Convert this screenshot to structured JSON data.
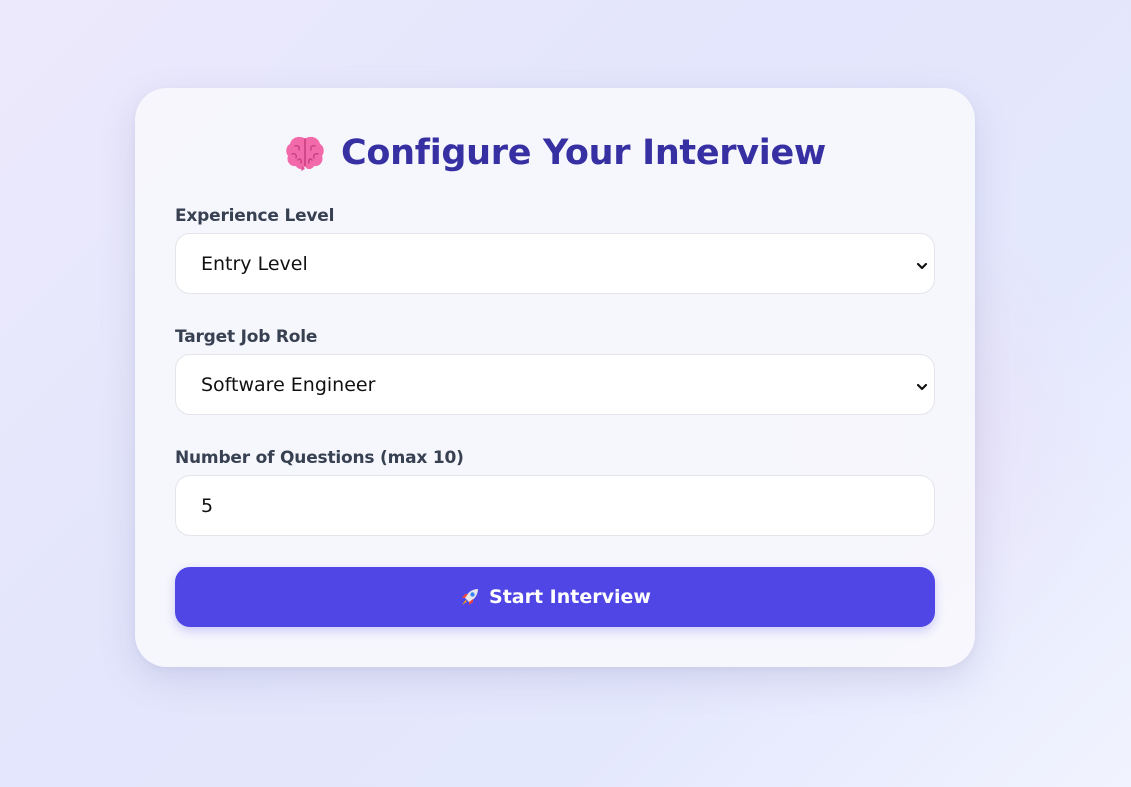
{
  "form": {
    "title": "Configure Your Interview",
    "title_icon": "brain-icon",
    "experience": {
      "label": "Experience Level",
      "selected": "Entry Level"
    },
    "role": {
      "label": "Target Job Role",
      "selected": "Software Engineer"
    },
    "questions": {
      "label": "Number of Questions (max 10)",
      "value": "5"
    },
    "submit": {
      "label": "Start Interview",
      "icon": "rocket-icon"
    }
  },
  "colors": {
    "title": "#3730a3",
    "button": "#4f46e5",
    "label": "#374151"
  }
}
